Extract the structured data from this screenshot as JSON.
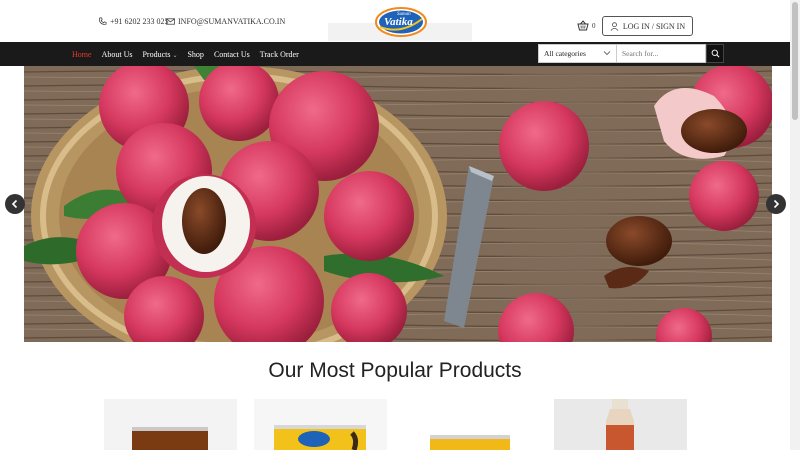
{
  "header": {
    "phone": "+91 6202 233 025",
    "email": "INFO@SUMANVATIKA.CO.IN",
    "logo_text": "Vatika",
    "logo_sub": "Suman",
    "cart_count": "0",
    "login_label": "LOG IN / SIGN IN"
  },
  "nav": {
    "items": [
      {
        "label": "Home"
      },
      {
        "label": "About Us"
      },
      {
        "label": "Products"
      },
      {
        "label": "Shop"
      },
      {
        "label": "Contact Us"
      },
      {
        "label": "Track Order"
      }
    ],
    "category_select": "All categories",
    "search_placeholder": "Search for..."
  },
  "main": {
    "section_title": "Our Most Popular Products"
  },
  "colors": {
    "accent": "#e63b2e",
    "navbar": "#1a1a1a"
  }
}
